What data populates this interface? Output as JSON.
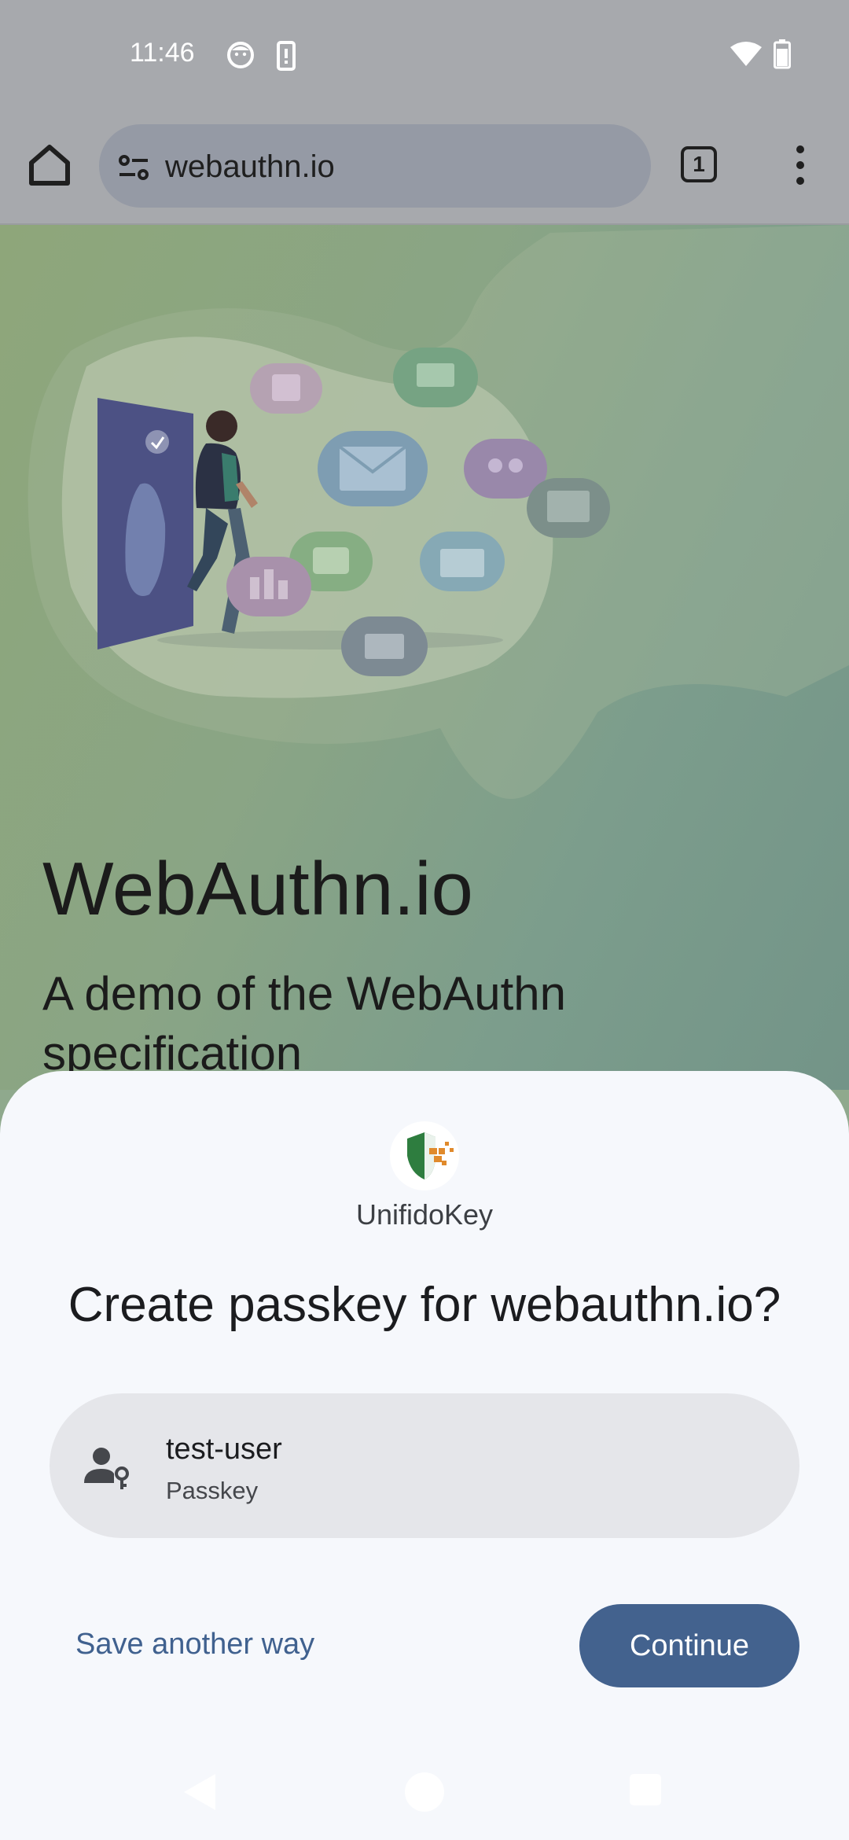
{
  "status_bar": {
    "time": "11:46",
    "icons": [
      "face-icon",
      "device-icon",
      "wifi-icon",
      "battery-icon"
    ]
  },
  "browser": {
    "url": "webauthn.io",
    "tab_count": "1",
    "icons": [
      "home-icon",
      "tune-icon",
      "tab-switcher-icon",
      "more-vert-icon"
    ]
  },
  "page": {
    "title": "WebAuthn.io",
    "subtitle": "A demo of the WebAuthn specification"
  },
  "sheet": {
    "app_name": "UnifidoKey",
    "title": "Create passkey for webauthn.io?",
    "account": {
      "name": "test-user",
      "type": "Passkey"
    },
    "secondary_button": "Save another way",
    "primary_button": "Continue"
  },
  "colors": {
    "status_bar_bg": "#a7a9ad",
    "sheet_bg": "#f6f8fc",
    "primary": "#43628e",
    "link": "#40618f",
    "card_bg": "#e5e6ea"
  }
}
